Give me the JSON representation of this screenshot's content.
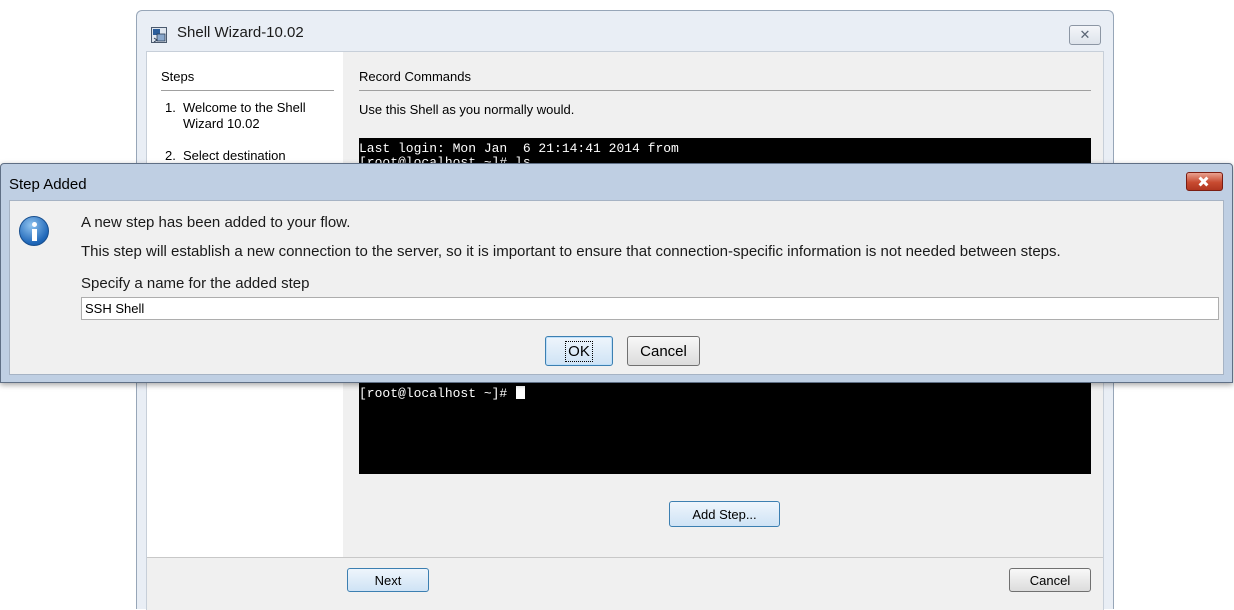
{
  "wizard": {
    "title": "Shell Wizard-10.02",
    "close_glyph": "✕",
    "steps_heading": "Steps",
    "steps": [
      {
        "num": "1.",
        "label": "Welcome to the Shell Wizard 10.02"
      },
      {
        "num": "2.",
        "label": "Select destination"
      }
    ],
    "record_heading": "Record Commands",
    "record_description": "Use this Shell as you normally would.",
    "terminal": {
      "line1": "Last login: Mon Jan  6 21:14:41 2014 from",
      "line2": "[root@localhost ~]# ls",
      "prompt": "[root@localhost ~]# "
    },
    "add_step_label": "Add Step...",
    "next_label": "Next",
    "cancel_label": "Cancel"
  },
  "dialog": {
    "title": "Step Added",
    "icon": "info-icon",
    "message_line1": "A new step has been added to your flow.",
    "message_line2": "This step will establish a new connection to the server, so it is important to ensure that connection-specific information is not needed between steps.",
    "prompt_label": "Specify a name for the added step",
    "step_name_value": "SSH Shell",
    "ok_label": "OK",
    "cancel_label": "Cancel"
  }
}
